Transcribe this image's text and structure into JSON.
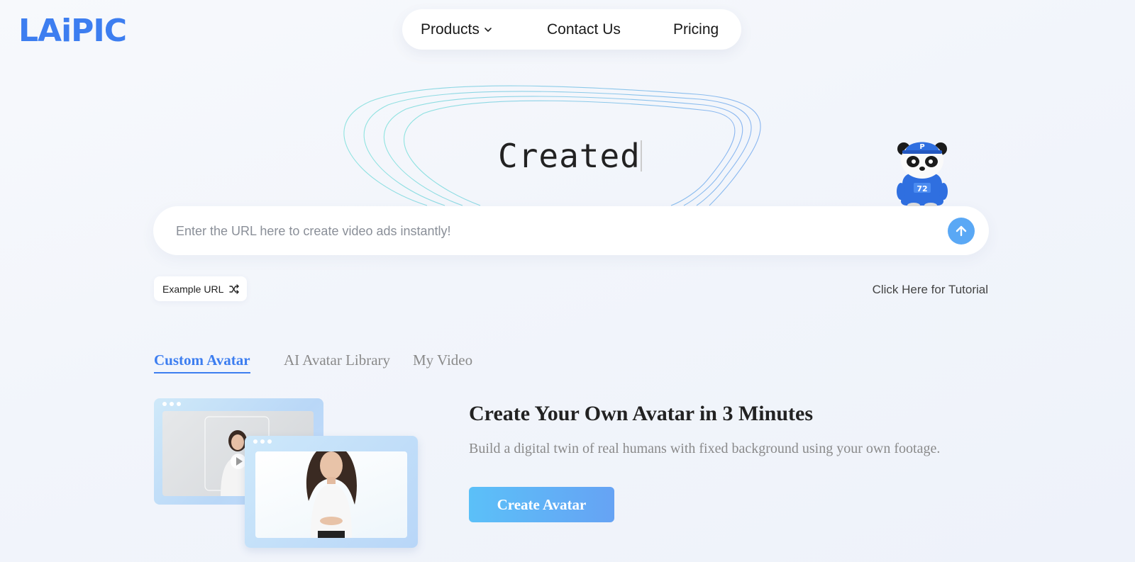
{
  "header": {
    "logo": "LAiPIC",
    "nav": {
      "products": "Products",
      "contact": "Contact Us",
      "pricing": "Pricing"
    }
  },
  "hero": {
    "typed_word": "Created",
    "search": {
      "placeholder": "Enter the URL here to create video ads instantly!",
      "value": ""
    },
    "example_button": "Example URL",
    "tutorial_link": "Click Here for Tutorial"
  },
  "tabs": [
    {
      "label": "Custom Avatar",
      "active": true
    },
    {
      "label": "AI Avatar Library",
      "active": false
    },
    {
      "label": "My Video",
      "active": false
    }
  ],
  "feature": {
    "title": "Create Your Own Avatar in 3 Minutes",
    "description": "Build a digital twin of real humans with fixed background using your own footage.",
    "button": "Create Avatar"
  },
  "colors": {
    "brand": "#3d7ef0",
    "submit_button": "#5aa8f5",
    "cta_gradient_start": "#5bc0f8",
    "cta_gradient_end": "#66a3f4"
  },
  "icons": {
    "chevron": "chevron-down-icon",
    "submit": "arrow-up-icon",
    "shuffle": "shuffle-icon",
    "mascot": "panda-mascot"
  }
}
